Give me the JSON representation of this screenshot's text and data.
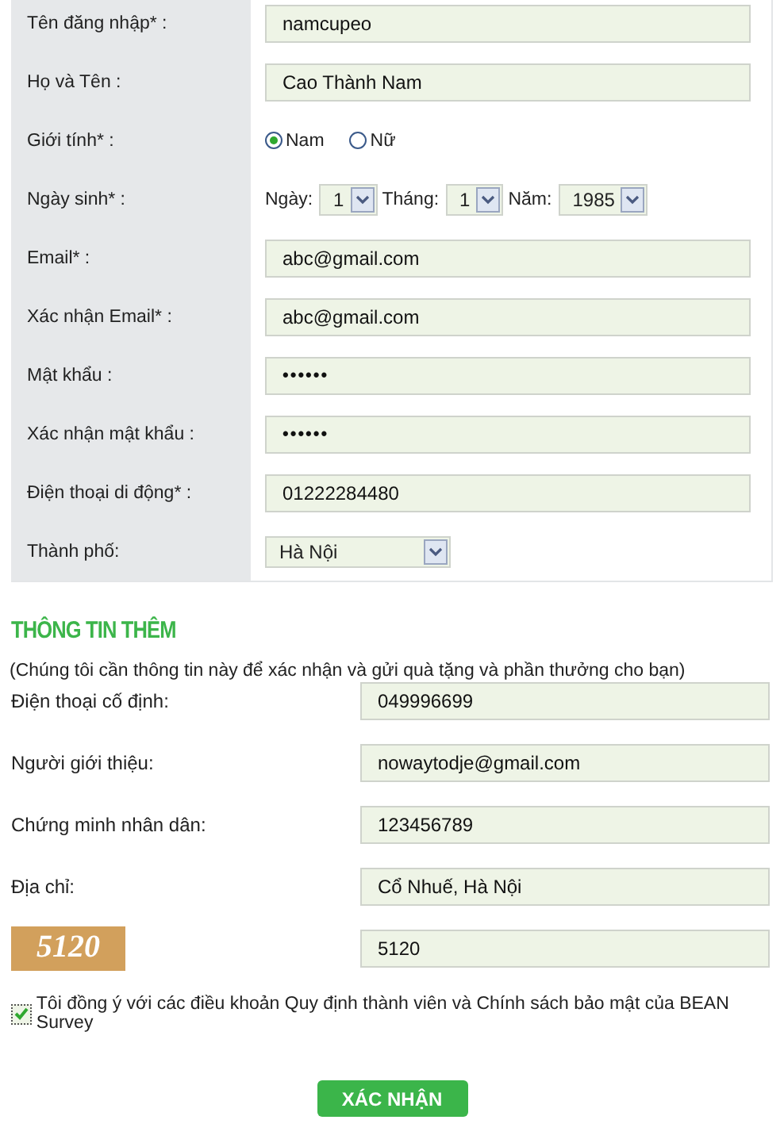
{
  "account_fields": [
    {
      "kind": "text",
      "label": "Tên đăng nhập* :",
      "value": "namcupeo"
    },
    {
      "kind": "text",
      "label": "Họ và Tên :",
      "value": "Cao Thành Nam"
    },
    {
      "kind": "gender",
      "label": "Giới tính* :",
      "options": [
        {
          "label": "Nam",
          "selected": true
        },
        {
          "label": "Nữ",
          "selected": false
        }
      ]
    },
    {
      "kind": "date",
      "label": "Ngày sinh* :",
      "parts": [
        {
          "label": "Ngày:",
          "value": "1"
        },
        {
          "label": "Tháng:",
          "value": "1"
        },
        {
          "label": "Năm:",
          "value": "1985"
        }
      ]
    },
    {
      "kind": "text",
      "label": "Email* :",
      "value": "abc@gmail.com"
    },
    {
      "kind": "text",
      "label": "Xác nhận Email* :",
      "value": "abc@gmail.com"
    },
    {
      "kind": "password",
      "label": "Mật khẩu :",
      "value": "••••••"
    },
    {
      "kind": "password",
      "label": "Xác nhận mật khẩu :",
      "value": "••••••"
    },
    {
      "kind": "text",
      "label": "Điện thoại di động* :",
      "value": "01222284480"
    },
    {
      "kind": "select",
      "label": "Thành phố:",
      "value": "Hà Nội"
    }
  ],
  "extra": {
    "title": "THÔNG TIN THÊM",
    "note": "(Chúng tôi cần thông tin này để xác nhận và gửi quà tặng và phần thưởng cho bạn)",
    "fields": [
      {
        "label": "Điện thoại cố định:",
        "value": "049996699"
      },
      {
        "label": "Người giới thiệu:",
        "value": "nowaytodje@gmail.com"
      },
      {
        "label": "Chứng minh nhân dân:",
        "value": "123456789"
      },
      {
        "label": "Địa chỉ:",
        "value": "Cổ Nhuế, Hà Nội"
      }
    ],
    "captcha": {
      "text": "5120",
      "value": "5120"
    }
  },
  "agreement": {
    "checked": true,
    "text": "Tôi đồng ý với các điều khoản Quy định thành viên và Chính sách bảo mật của BEAN Survey"
  },
  "submit": "XÁC NHẬN"
}
